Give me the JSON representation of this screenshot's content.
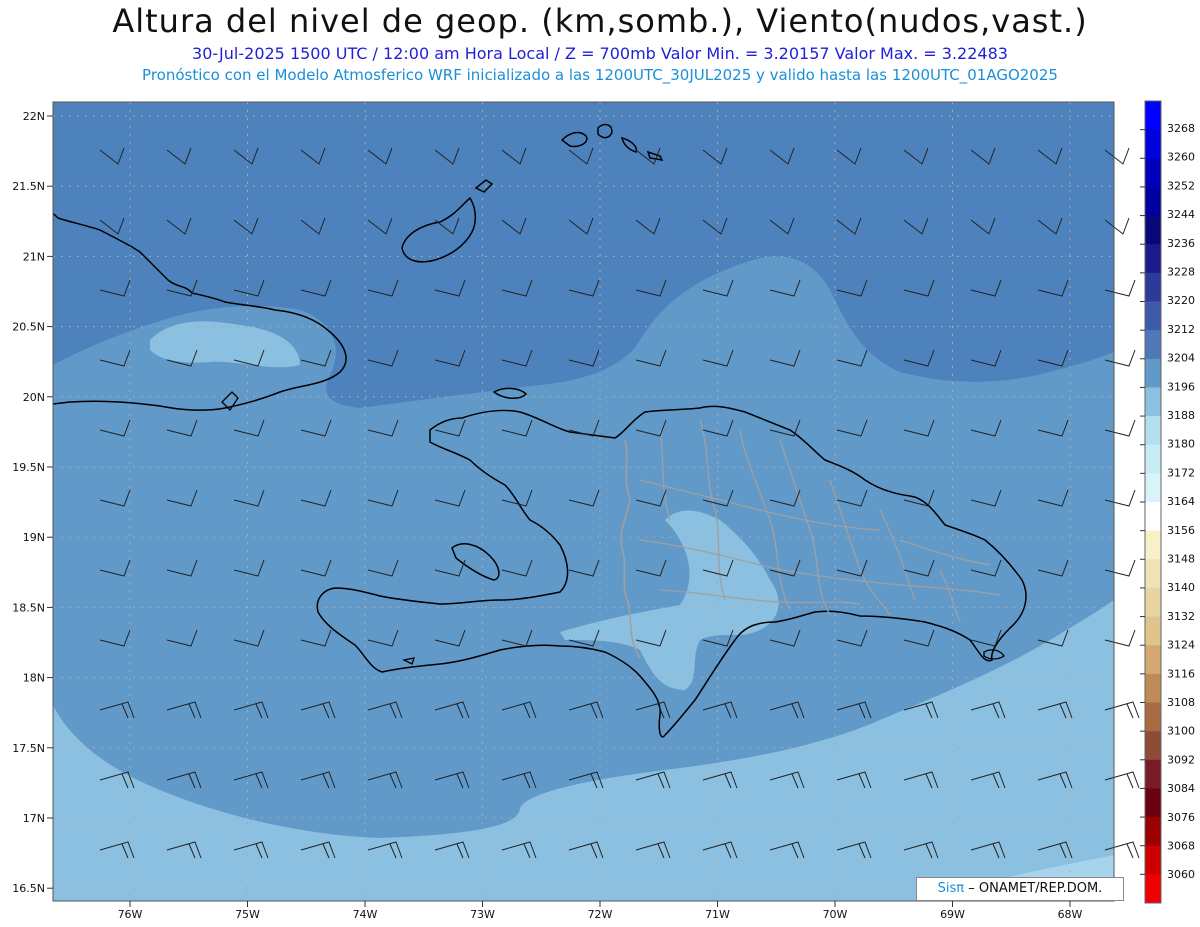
{
  "header": {
    "title": "Altura del nivel de geop. (km,somb.), Viento(nudos,vast.)",
    "line2": "30-Jul-2025  1500 UTC / 12:00 am Hora Local / Z = 700mb   Valor Min. = 3.20157  Valor Max. = 3.22483",
    "line3": "Pronóstico con el Modelo Atmosferico WRF inicializado a las 1200UTC_30JUL2025 y valido hasta las  1200UTC_01AGO2025"
  },
  "map": {
    "lat_labels": [
      "22N",
      "21.5N",
      "21N",
      "20.5N",
      "20N",
      "19.5N",
      "19N",
      "18.5N",
      "18N",
      "17.5N",
      "17N",
      "16.5N"
    ],
    "lon_labels": [
      "76W",
      "75W",
      "74W",
      "73W",
      "72W",
      "71W",
      "70W",
      "69W",
      "68W"
    ],
    "region": "Hispaniola / Caribe",
    "colors": {
      "ocean_north": "#4e82bd",
      "mid_band": "#6199c9",
      "south_band": "#8cc0e0",
      "light_patch": "#a7d3ec",
      "coast": "#000000",
      "provinces": "#a0a0a0",
      "barbs": "#222222"
    }
  },
  "colorbar": {
    "labels": [
      "3268",
      "3260",
      "3252",
      "3244",
      "3236",
      "3228",
      "3220",
      "3212",
      "3204",
      "3196",
      "3188",
      "3180",
      "3172",
      "3164",
      "3156",
      "3148",
      "3140",
      "3132",
      "3124",
      "3116",
      "3108",
      "3100",
      "3092",
      "3084",
      "3076",
      "3068",
      "3060"
    ],
    "colors": [
      "#0000ff",
      "#0000dd",
      "#0000bb",
      "#0000a0",
      "#08087a",
      "#1a1a8c",
      "#2c3a9c",
      "#3d5aab",
      "#4e78b8",
      "#6199c9",
      "#8cc0e0",
      "#b4dff0",
      "#c8ecf4",
      "#d8f4f8",
      "#ffffff",
      "#f7f0c8",
      "#f0e2b4",
      "#e8d4a0",
      "#e0c48c",
      "#d4a870",
      "#c08a58",
      "#a86c44",
      "#8e4c36",
      "#7a1c28",
      "#6a0010",
      "#9c0000",
      "#cc0000",
      "#f00000"
    ]
  },
  "credit": {
    "sis": "Sisπ",
    "text": "– ONAMET/REP.DOM."
  }
}
